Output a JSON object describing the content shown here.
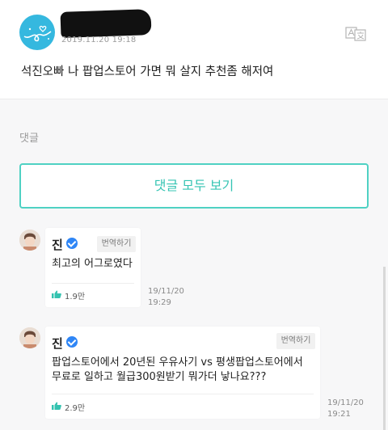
{
  "post": {
    "date": "2019.11.20 19:18",
    "text": "석진오빠 나 팝업스토어 가면 뭐 살지 추천좀 해저여",
    "translate_icon": "translate-icon"
  },
  "comments_section": {
    "label": "댓글",
    "view_all_label": "댓글 모두 보기"
  },
  "comments": [
    {
      "author": "진",
      "translate_label": "번역하기",
      "lines": [
        "최고의 어그로였다"
      ],
      "likes": "1.9만",
      "date_line1": "19/11/20",
      "date_line2": "19:29"
    },
    {
      "author": "진",
      "translate_label": "번역하기",
      "lines": [
        "팝업스토어에서 20년된 우유사기 vs 평생팝업스토어에서",
        "무료로 일하고 월급300원받기 뭐가더 낳나요???"
      ],
      "likes": "2.9만",
      "date_line1": "19/11/20",
      "date_line2": "19:21"
    }
  ],
  "colors": {
    "accent": "#35c4b3",
    "verified": "#2f86f6",
    "like": "#34c3b0"
  }
}
